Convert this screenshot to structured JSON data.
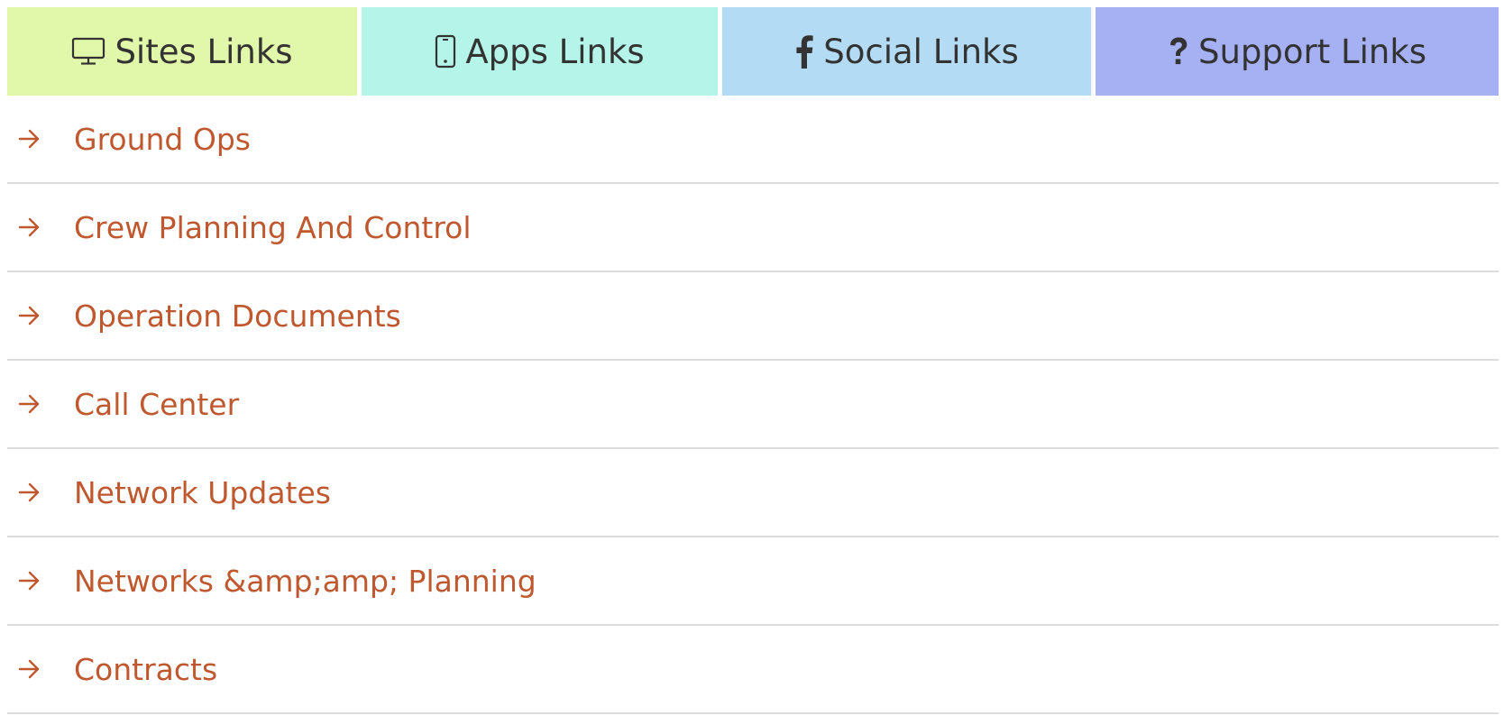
{
  "tabs": [
    {
      "label": "Sites Links",
      "icon": "monitor-icon",
      "color": "#e1f7aa"
    },
    {
      "label": "Apps Links",
      "icon": "smartphone-icon",
      "color": "#b5f4e8"
    },
    {
      "label": "Social Links",
      "icon": "facebook-icon",
      "color": "#b3dcf4"
    },
    {
      "label": "Support Links",
      "icon": "question-icon",
      "color": "#a6b1f4"
    }
  ],
  "links": {
    "icon": "arrow-right-icon",
    "color": "#c0582f",
    "items": [
      {
        "label": "Ground Ops"
      },
      {
        "label": "Crew Planning And Control"
      },
      {
        "label": "Operation Documents"
      },
      {
        "label": "Call Center"
      },
      {
        "label": "Network Updates"
      },
      {
        "label": "Networks &amp;amp; Planning"
      },
      {
        "label": "Contracts"
      }
    ]
  }
}
